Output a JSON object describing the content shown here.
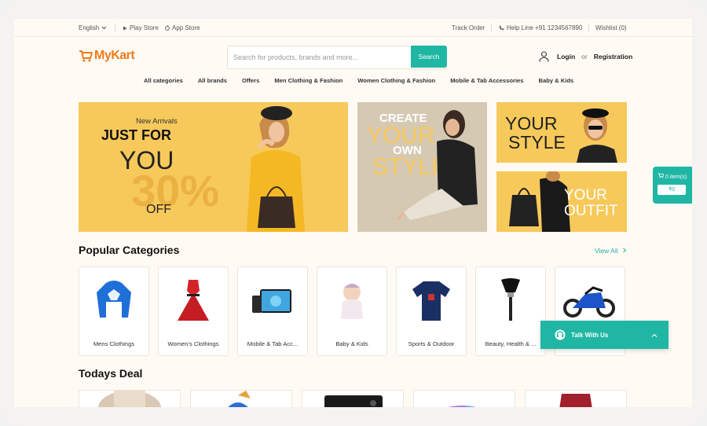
{
  "topbar": {
    "language": "English",
    "play_store": "Play Store",
    "app_store": "App Store",
    "track_order": "Track Order",
    "helpline": "Help Line +91 1234567890",
    "wishlist": "Wishlist (0)"
  },
  "brand": {
    "logo_text": "MyKart"
  },
  "search": {
    "placeholder": "Search for products, brands and more...",
    "value": "",
    "button": "Search"
  },
  "account": {
    "login": "Login",
    "or": "or",
    "registration": "Registration"
  },
  "nav": [
    "All categories",
    "All brands",
    "Offers",
    "Men Clothing & Fashion",
    "Women Clothing & Fashion",
    "Mobile & Tab Accessories",
    "Baby & Kids"
  ],
  "banners": {
    "main": {
      "kicker": "New Arrivals",
      "line1": "JUST FOR",
      "line2": "YOU",
      "percent": "30%",
      "off": "OFF"
    },
    "create": {
      "line1": "CREATE",
      "line2": "YOUR",
      "line3": "OWN",
      "line4": "STYLE"
    },
    "your_style": {
      "line1": "YOUR",
      "line2": "STYLE"
    },
    "your_outfit": {
      "line1": "YOUR",
      "line2": "OUTFIT"
    }
  },
  "popular": {
    "title": "Popular Categories",
    "view_all": "View All",
    "items": [
      "Mens Clothings",
      "Women's Clothings",
      "Mobile & Tab Acc...",
      "Baby & Kids",
      "Sports & Outdoor",
      "Beauty, Health & ...",
      ""
    ]
  },
  "deals": {
    "title": "Todays Deal"
  },
  "cart_widget": {
    "count": "0 item(s)",
    "amount": "₹0"
  },
  "chat": {
    "label": "Talk With Us"
  },
  "colors": {
    "accent": "#1fb7a4",
    "brand": "#f07a1c",
    "banner_yellow": "#f7c95a"
  }
}
